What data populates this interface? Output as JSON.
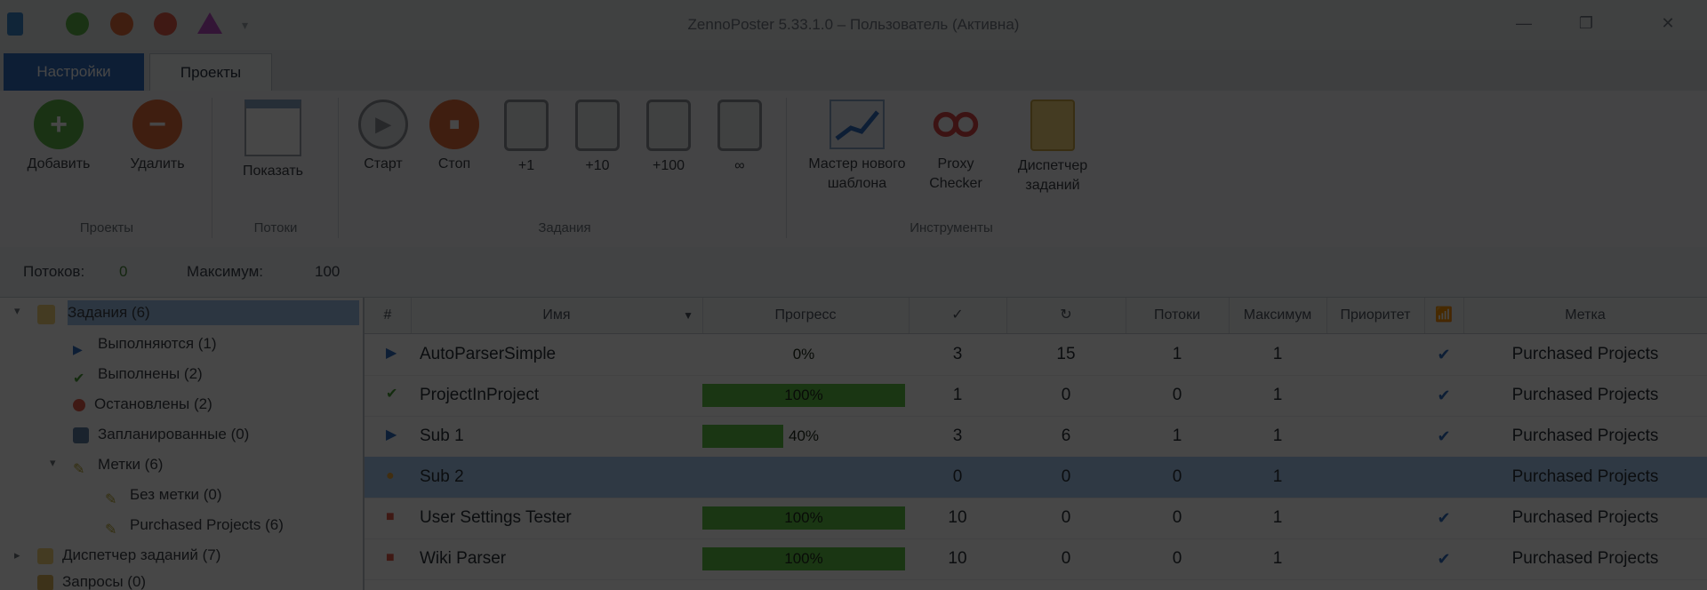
{
  "window": {
    "title": "ZennoPoster 5.33.1.0 – Пользователь (Активна)"
  },
  "ribbon": {
    "tabs": [
      "Настройки",
      "Проекты"
    ],
    "buttons": [
      {
        "label": "Добавить",
        "icon": "add-circle-icon"
      },
      {
        "label": "Удалить",
        "icon": "remove-circle-icon"
      },
      {
        "label": "Показать",
        "icon": "show-window-icon"
      },
      {
        "label": "Старт",
        "icon": "start-icon"
      },
      {
        "label": "Стоп",
        "icon": "stop-icon"
      },
      {
        "label": "+1",
        "icon": "plus-one-icon"
      },
      {
        "label": "+10",
        "icon": "plus-ten-icon"
      },
      {
        "label": "+100",
        "icon": "plus-hundred-icon"
      },
      {
        "label": "∞",
        "icon": "infinity-icon"
      },
      {
        "label": "Мастер нового шаблона",
        "icon": "wizard-chart-icon"
      },
      {
        "label": "Proxy Checker",
        "icon": "proxy-checker-icon"
      },
      {
        "label": "Диспетчер заданий",
        "icon": "task-dispatcher-icon"
      }
    ],
    "groups": [
      "Проекты",
      "Потоки",
      "Задания",
      "Инструменты"
    ]
  },
  "threadbar": {
    "threads_label": "Потоков:",
    "threads_value": "0",
    "max_label": "Максимум:",
    "max_value": "100"
  },
  "tree": {
    "items": [
      {
        "label": "Задания (6)",
        "selected": true
      },
      {
        "label": "Выполняются (1)"
      },
      {
        "label": "Выполнены (2)"
      },
      {
        "label": "Остановлены (2)"
      },
      {
        "label": "Запланированные (0)"
      },
      {
        "label": "Метки (6)"
      },
      {
        "label": "Без метки (0)"
      },
      {
        "label": "Purchased Projects (6)"
      },
      {
        "label": "Диспетчер заданий (7)"
      },
      {
        "label": "Запросы (0)"
      }
    ]
  },
  "grid": {
    "headers": [
      "#",
      "Имя",
      "Прогресс",
      "✓",
      "↻",
      "Потоки",
      "Максимум",
      "Приоритет",
      "📶",
      "Метка"
    ],
    "rows": [
      {
        "status": "running",
        "name": "AutoParserSimple",
        "progress_text": "0%",
        "progress": 0,
        "done": "3",
        "attempts": "15",
        "threads": "1",
        "max": "1",
        "checked": true,
        "label": "Purchased Projects"
      },
      {
        "status": "done",
        "name": "ProjectInProject",
        "progress_text": "100%",
        "progress": 100,
        "done": "1",
        "attempts": "0",
        "threads": "0",
        "max": "1",
        "checked": true,
        "label": "Purchased Projects"
      },
      {
        "status": "running",
        "name": "Sub 1",
        "progress_text": "40%",
        "progress": 40,
        "done": "3",
        "attempts": "6",
        "threads": "1",
        "max": "1",
        "checked": true,
        "label": "Purchased Projects"
      },
      {
        "status": "scheduled",
        "name": "Sub 2",
        "progress_text": "",
        "progress": 0,
        "done": "0",
        "attempts": "0",
        "threads": "0",
        "max": "1",
        "checked": false,
        "label": "Purchased Projects"
      },
      {
        "status": "stopped",
        "name": "User Settings Tester",
        "progress_text": "100%",
        "progress": 100,
        "done": "10",
        "attempts": "0",
        "threads": "0",
        "max": "1",
        "checked": true,
        "label": "Purchased Projects"
      },
      {
        "status": "stopped",
        "name": "Wiki Parser",
        "progress_text": "100%",
        "progress": 100,
        "done": "10",
        "attempts": "0",
        "threads": "0",
        "max": "1",
        "checked": true,
        "label": "Purchased Projects"
      }
    ]
  },
  "colors": {
    "accent": "#2f6bbd",
    "progress": "#5fc046",
    "selection": "#a9cdf2",
    "overlay": "rgba(0,0,0,0.72)"
  }
}
